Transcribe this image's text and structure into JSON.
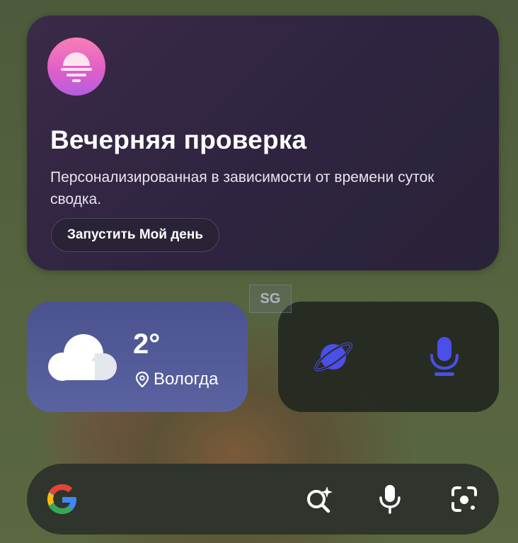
{
  "evening_card": {
    "icon": "sunset-icon",
    "title": "Вечерняя проверка",
    "description": "Персонализированная в зависимости от времени суток сводка.",
    "button_label": "Запустить Мой день",
    "colors": {
      "background": "#2e2440",
      "badge_top": "#f77fb6",
      "badge_bottom": "#b45ee0"
    }
  },
  "weather": {
    "icon": "cloud-icon",
    "temperature": "2°",
    "location_icon": "location-pin-icon",
    "location": "Вологда",
    "colors": {
      "background": "#4f5896"
    }
  },
  "shortcuts": {
    "items": [
      {
        "icon": "planet-icon",
        "color": "#4b4ff0"
      },
      {
        "icon": "microphone-icon",
        "color": "#4b4ff0"
      }
    ]
  },
  "search_bar": {
    "logo": "google-logo",
    "icons": [
      "ai-search-icon",
      "microphone-icon",
      "lens-camera-icon"
    ]
  },
  "watermark": {
    "text": "SG"
  }
}
